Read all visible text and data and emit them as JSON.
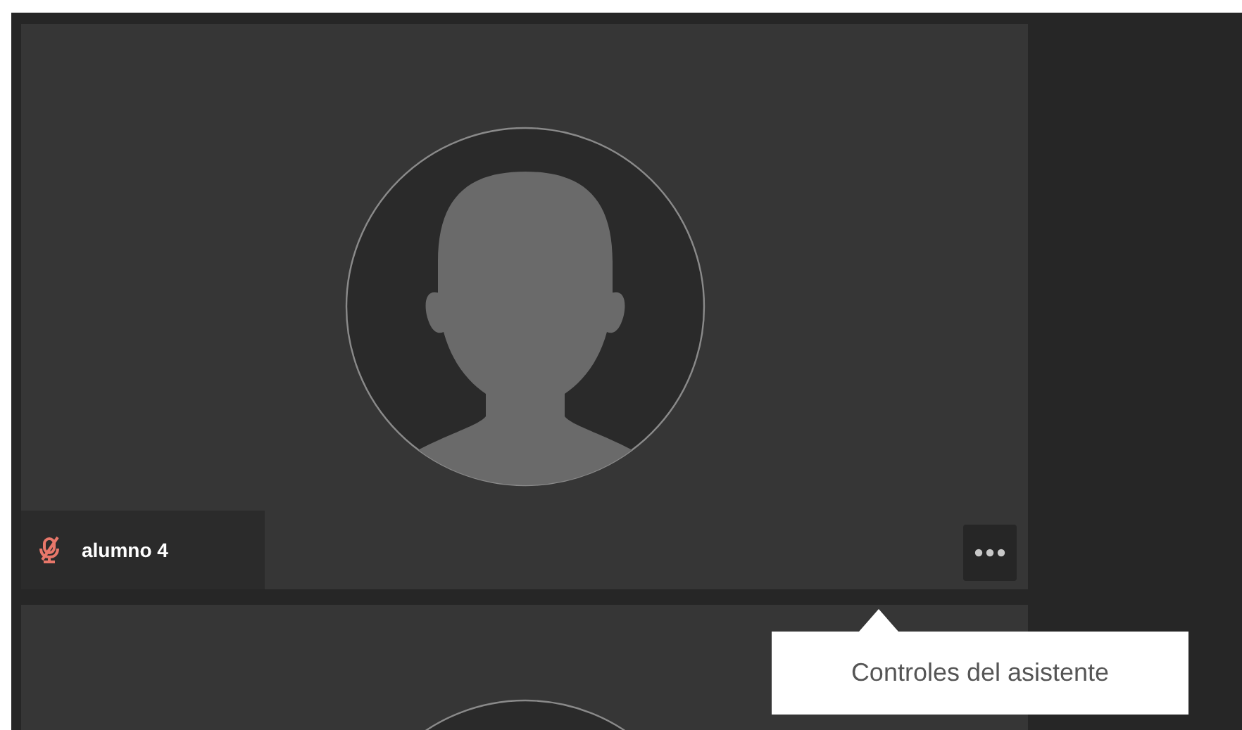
{
  "tiles": [
    {
      "kind": "participant",
      "name": "alumno 4",
      "muted": true
    },
    {
      "kind": "partial"
    }
  ],
  "tooltip": {
    "text": "Controles del asistente"
  }
}
